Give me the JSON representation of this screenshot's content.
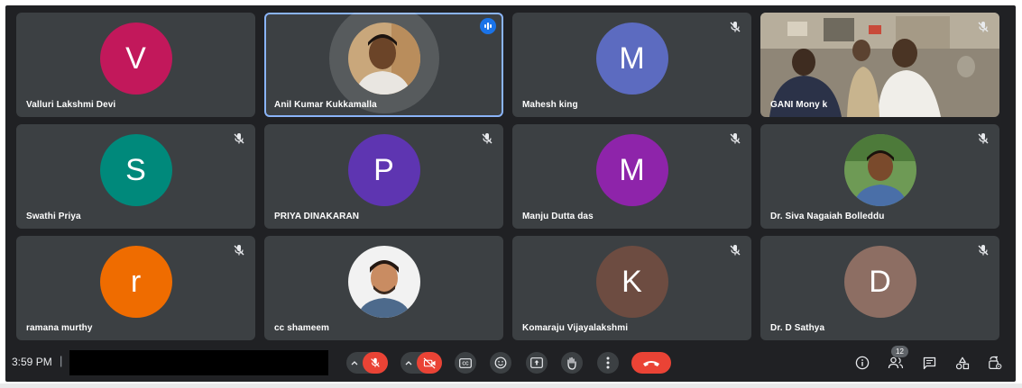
{
  "participants": [
    {
      "name": "Valluri Lakshmi Devi",
      "initial": "V",
      "color": "#c2185b",
      "muted": false
    },
    {
      "name": "Anil Kumar Kukkamalla",
      "initial": "",
      "color": "",
      "muted": false
    },
    {
      "name": "Mahesh king",
      "initial": "M",
      "color": "#5c6bc0",
      "muted": true
    },
    {
      "name": "GANI Mony k",
      "initial": "",
      "color": "",
      "muted": true
    },
    {
      "name": "Swathi Priya",
      "initial": "S",
      "color": "#00897b",
      "muted": true
    },
    {
      "name": "PRIYA DINAKARAN",
      "initial": "P",
      "color": "#5e35b1",
      "muted": true
    },
    {
      "name": "Manju Dutta das",
      "initial": "M",
      "color": "#8e24aa",
      "muted": true
    },
    {
      "name": "Dr. Siva Nagaiah Bolleddu",
      "initial": "",
      "color": "",
      "muted": true
    },
    {
      "name": "ramana murthy",
      "initial": "r",
      "color": "#ef6c00",
      "muted": true
    },
    {
      "name": "cc shameem",
      "initial": "",
      "color": "",
      "muted": false
    },
    {
      "name": "Komaraju Vijayalakshmi",
      "initial": "K",
      "color": "#6d4c41",
      "muted": true
    },
    {
      "name": "Dr. D Sathya",
      "initial": "D",
      "color": "#8d6e63",
      "muted": true
    }
  ],
  "controls": {
    "time": "3:59 PM",
    "separator": "|",
    "participant_count": "12",
    "colors": {
      "end_call": "#ea4335",
      "active_speaker": "#1a73e8"
    }
  }
}
